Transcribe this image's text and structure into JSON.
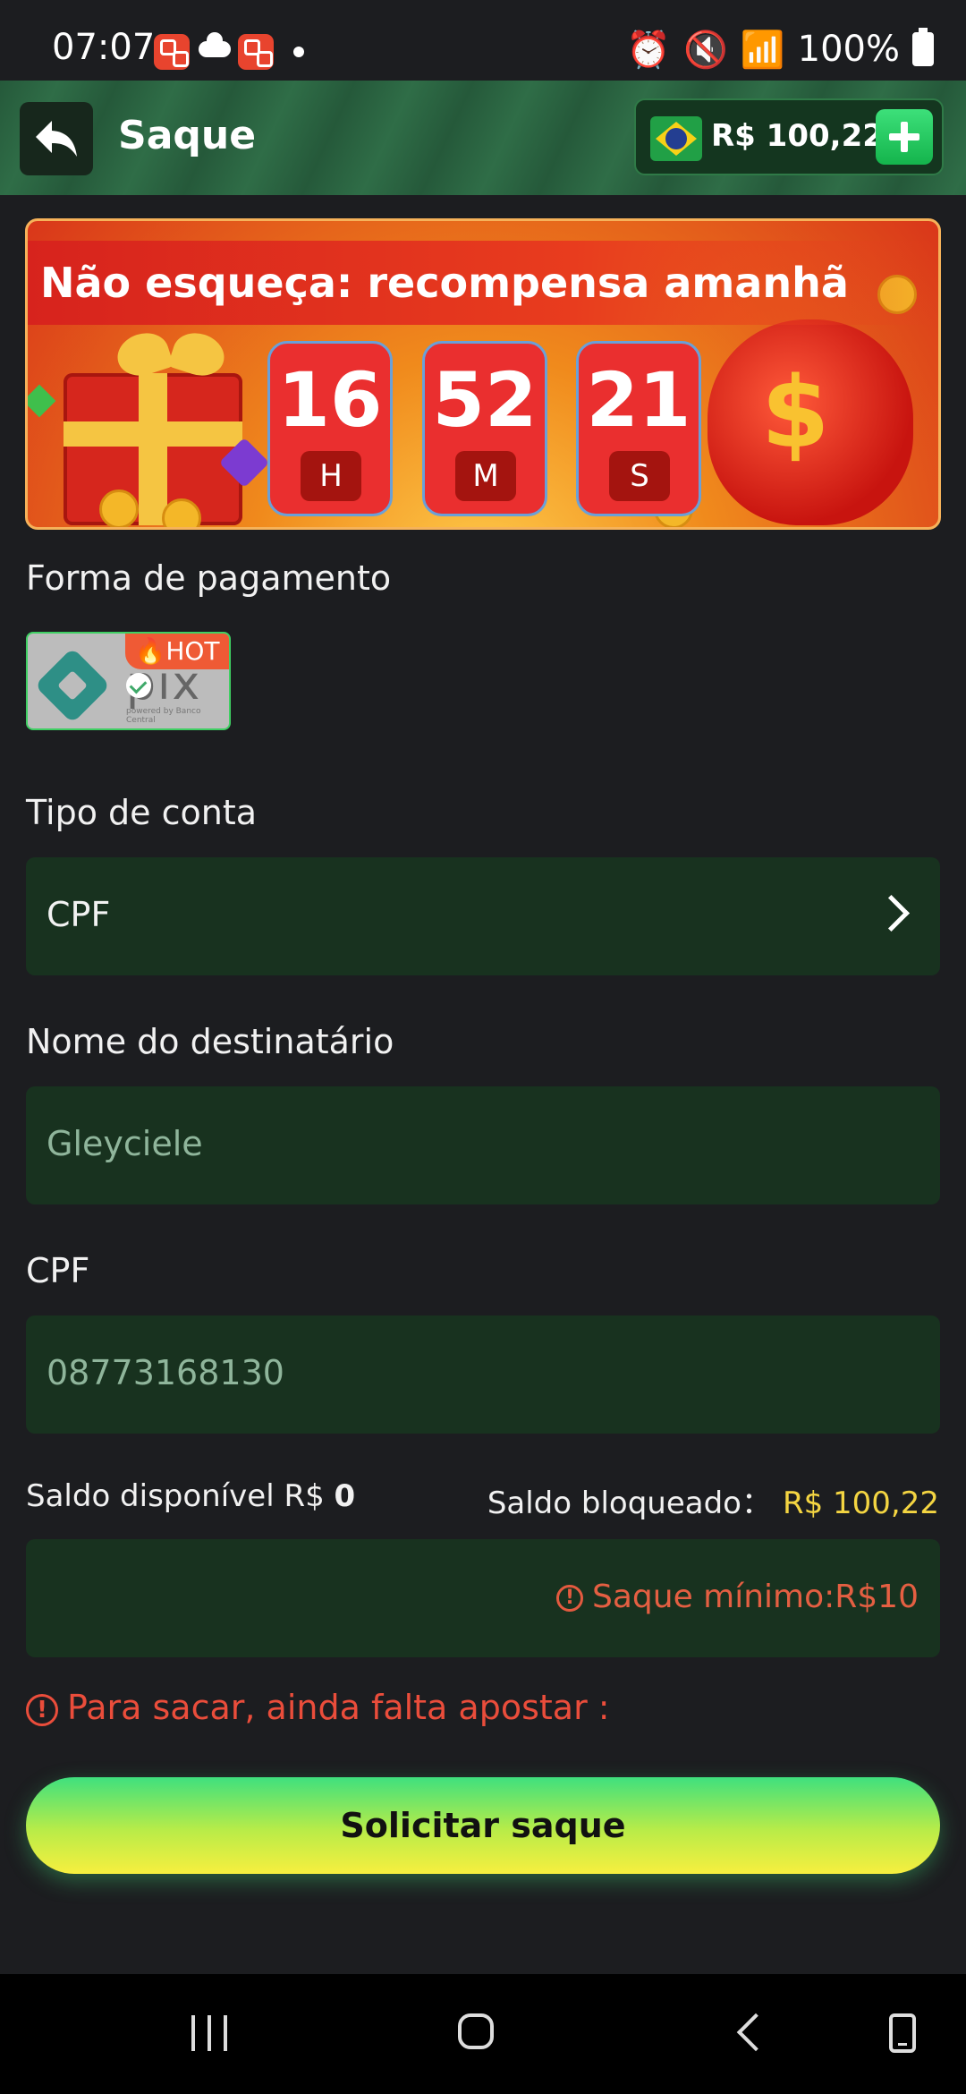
{
  "status_bar": {
    "time": "07:07",
    "battery": "100%",
    "icons": [
      "app-notification-icon",
      "cloud-icon",
      "app-notification-icon",
      "dot-icon",
      "alarm-icon",
      "mute-icon",
      "wifi-icon",
      "signal-icon",
      "battery-icon"
    ]
  },
  "header": {
    "title": "Saque",
    "balance": "R$ 100,22",
    "flag": "brazil-flag-icon"
  },
  "banner": {
    "title": "Não esqueça: recompensa amanhã",
    "timer": [
      {
        "value": "16",
        "unit": "H"
      },
      {
        "value": "52",
        "unit": "M"
      },
      {
        "value": "21",
        "unit": "S"
      }
    ]
  },
  "form": {
    "payment_label": "Forma de pagamento",
    "payment_method": {
      "name": "pix",
      "badge": "HOT",
      "sub": "powered by Banco Central"
    },
    "account_type_label": "Tipo de conta",
    "account_type_value": "CPF",
    "recipient_label": "Nome do destinatário",
    "recipient_value": "Gleyciele",
    "cpf_label": "CPF",
    "cpf_value": "08773168130",
    "available_label": "Saldo disponível R$",
    "available_value": "0",
    "blocked_label": "Saldo bloqueado：",
    "blocked_value": "R$ 100,22",
    "amount_hint": "Saque mínimo:R$10",
    "bet_warning": "Para sacar, ainda falta apostar :",
    "submit_label": "Solicitar saque"
  },
  "colors": {
    "background": "#1c1d20",
    "field": "#18321f",
    "accent_green": "#3fe07e",
    "warning": "#ea4d3b",
    "yellow": "#f4d542"
  }
}
